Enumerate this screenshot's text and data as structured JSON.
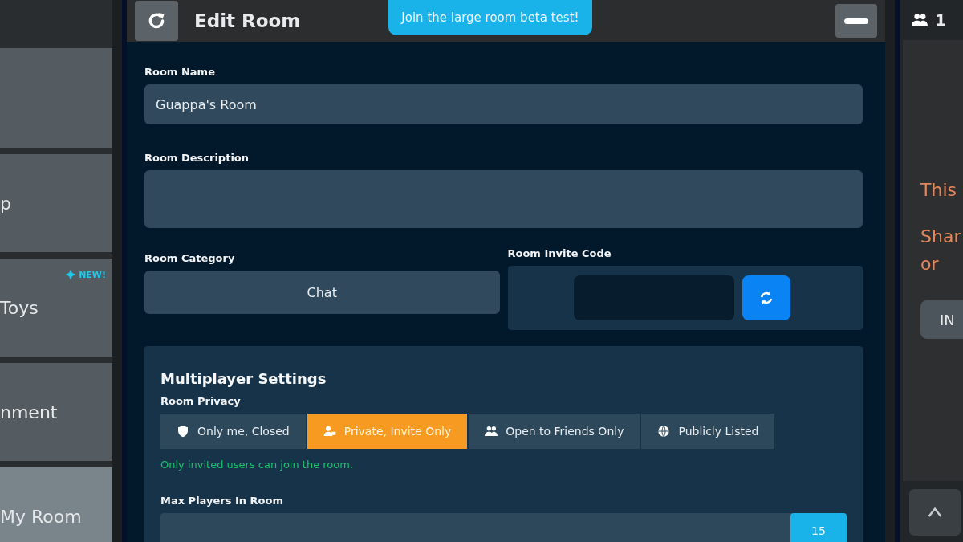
{
  "sidebar": {
    "items": [
      {
        "selected": false
      },
      {
        "label": "p",
        "selected": false
      },
      {
        "label": "Toys",
        "selected": false,
        "badge": "NEW!"
      },
      {
        "label": "nment",
        "selected": false
      },
      {
        "label": "My Room",
        "selected": true
      }
    ]
  },
  "header": {
    "title": "Edit Room",
    "banner": "Join the large room beta test!"
  },
  "form": {
    "room_name": {
      "label": "Room Name",
      "value": "Guappa's Room"
    },
    "room_description": {
      "label": "Room Description"
    },
    "room_category": {
      "label": "Room Category",
      "value": "Chat"
    },
    "invite_code": {
      "label": "Room Invite Code"
    },
    "multiplayer": {
      "title": "Multiplayer Settings",
      "privacy_label": "Room Privacy",
      "privacy_options": [
        {
          "label": "Only me, Closed",
          "selected": false
        },
        {
          "label": "Private, Invite Only",
          "selected": true
        },
        {
          "label": "Open to Friends Only",
          "selected": false
        },
        {
          "label": "Publicly Listed",
          "selected": false
        }
      ],
      "privacy_hint": "Only invited users can join the room.",
      "max_players": {
        "label": "Max Players In Room",
        "value": "15",
        "level": 1
      }
    }
  },
  "right_panel": {
    "count": "1",
    "lines": [
      "This",
      "Shar",
      "or"
    ],
    "button": "IN"
  }
}
